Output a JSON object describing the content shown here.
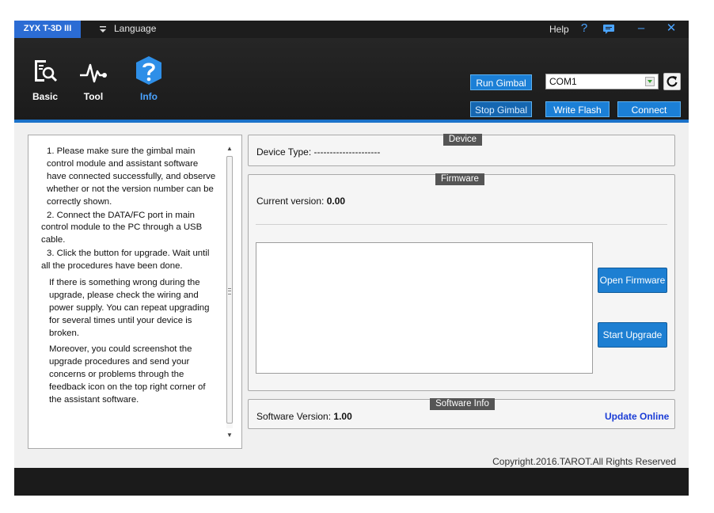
{
  "titlebar": {
    "app_name": "ZYX T-3D III",
    "language_label": "Language",
    "help_label": "Help",
    "icons": [
      "help-icon",
      "feedback-icon",
      "minimize-icon",
      "close-icon"
    ],
    "help_glyph": "?",
    "minimize_glyph": "–",
    "close_glyph": "✕"
  },
  "nav": {
    "items": [
      {
        "label": "Basic",
        "icon": "magnifier-document-icon",
        "active": false
      },
      {
        "label": "Tool",
        "icon": "waveform-icon",
        "active": false
      },
      {
        "label": "Info",
        "icon": "info-help-icon",
        "active": true
      }
    ]
  },
  "header": {
    "run_gimbal": "Run Gimbal",
    "stop_gimbal": "Stop Gimbal",
    "port_value": "COM1",
    "write_flash": "Write Flash",
    "connect": "Connect"
  },
  "instructions": {
    "steps": [
      "1. Please make sure the gimbal main control module and assistant software have connected successfully, and observe whether or not the version number can be correctly shown.",
      "2. Connect the DATA/FC port in main control module to the PC through a USB cable.",
      "3. Click the button for upgrade. Wait until all the procedures have been done."
    ],
    "notes": [
      "If there is something wrong during the upgrade, please check the wiring and power supply. You can repeat upgrading for several times until your device is broken.",
      "Moreover, you could screenshot the upgrade procedures and send your concerns or problems through the feedback icon on the top right corner of the assistant software."
    ]
  },
  "device": {
    "title": "Device",
    "type_label": "Device Type:",
    "type_value": "---------------------"
  },
  "firmware": {
    "title": "Firmware",
    "current_version_label": "Current version:",
    "current_version_value": "0.00",
    "open_button": "Open Firmware",
    "upgrade_button": "Start Upgrade"
  },
  "software": {
    "title": "Software Info",
    "version_label": "Software Version:",
    "version_value": "1.00",
    "update_link": "Update Online"
  },
  "copyright": "Copyright.2016.TAROT.All Rights Reserved",
  "colors": {
    "accent": "#1b7fd6",
    "badge": "#2b6cd4",
    "link": "#1b3dd6",
    "header_bg": "#1c1c1c"
  }
}
